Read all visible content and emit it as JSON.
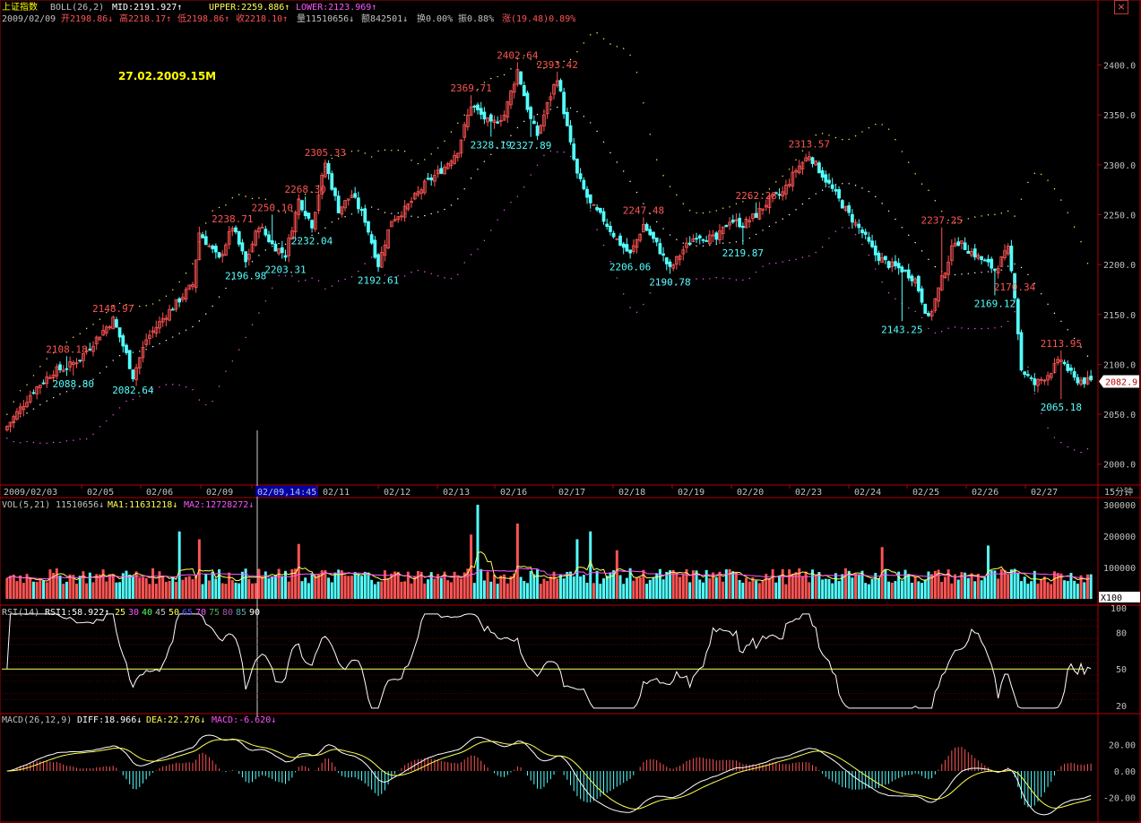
{
  "app": {
    "colors": {
      "background": "#000000",
      "up": "#ff5454",
      "down": "#54ffff",
      "frame": "#b40000",
      "grid": "#4a0000",
      "mid": "#ffffff",
      "upper": "#ffff54",
      "lower": "#ff54ff",
      "axis_text": "#c0c0c0"
    },
    "close_icon_glyph": "×"
  },
  "header": {
    "index_name": "上证指数",
    "boll_label": "BOLL(26,2)",
    "mid_text": "MID:2191.927↑",
    "upper_text": "UPPER:2259.886↑",
    "lower_text": "LOWER:2123.969↑",
    "date_text": "2009/02/09",
    "open_text": "开2198.86↓",
    "high_text": "高2218.17↑",
    "low_text": "低2198.86↑",
    "close_text": "收2218.10↑",
    "vol_text": "量11510656↓",
    "amount_text": "额842501↓",
    "turnover_text": "换0.00%",
    "amplitude_text": "振0.88%",
    "change_text": "涨(19.48)0.89%",
    "watermark": "27.02.2009.15M"
  },
  "xaxis": {
    "labels": [
      "2009/02/03",
      "02/05",
      "02/06",
      "02/09",
      "02/09,14:45",
      "02/11",
      "02/12",
      "02/13",
      "02/16",
      "02/17",
      "02/18",
      "02/19",
      "02/20",
      "02/23",
      "02/24",
      "02/25",
      "02/26",
      "02/27"
    ],
    "cursor_label": "02/09,14:45",
    "period_label": "15分钟"
  },
  "vol_header": {
    "label": "VOL(5,21)",
    "value": "11510656↓",
    "ma1": "MA1:11631218↓",
    "ma2": "MA2:12728272↓"
  },
  "rsi_header": {
    "label": "RSI(14)",
    "value": "RSI1:58.922↑",
    "levels": [
      "25",
      "30",
      "40",
      "45",
      "50",
      "65",
      "70",
      "75",
      "80",
      "85",
      "90"
    ]
  },
  "macd_header": {
    "label": "MACD(26,12,9)",
    "diff": "DIFF:18.966↓",
    "dea": "DEA:22.276↓",
    "macd": "MACD:-6.620↓"
  },
  "chart_data": [
    {
      "type": "candlestick",
      "title": "上证指数 BOLL(26,2)",
      "ylim": [
        1980,
        2440
      ],
      "yticks": [
        2000,
        2050,
        2100,
        2150,
        2200,
        2250,
        2300,
        2350,
        2400
      ],
      "last_price_tag": "2082.9",
      "anchors_close": [
        [
          0,
          2038
        ],
        [
          8,
          2074
        ],
        [
          14,
          2093
        ],
        [
          18,
          2097
        ],
        [
          22,
          2106
        ],
        [
          28,
          2130
        ],
        [
          32,
          2145
        ],
        [
          36,
          2110
        ],
        [
          38,
          2088
        ],
        [
          42,
          2125
        ],
        [
          48,
          2150
        ],
        [
          56,
          2180
        ],
        [
          58,
          2232
        ],
        [
          64,
          2205
        ],
        [
          68,
          2238
        ],
        [
          72,
          2202
        ],
        [
          76,
          2240
        ],
        [
          80,
          2220
        ],
        [
          84,
          2210
        ],
        [
          88,
          2265
        ],
        [
          92,
          2240
        ],
        [
          96,
          2302
        ],
        [
          100,
          2255
        ],
        [
          104,
          2270
        ],
        [
          108,
          2245
        ],
        [
          112,
          2200
        ],
        [
          116,
          2245
        ],
        [
          120,
          2255
        ],
        [
          126,
          2280
        ],
        [
          132,
          2298
        ],
        [
          136,
          2315
        ],
        [
          140,
          2360
        ],
        [
          146,
          2340
        ],
        [
          150,
          2350
        ],
        [
          154,
          2395
        ],
        [
          158,
          2345
        ],
        [
          160,
          2330
        ],
        [
          164,
          2370
        ],
        [
          166,
          2388
        ],
        [
          170,
          2320
        ],
        [
          172,
          2290
        ],
        [
          176,
          2260
        ],
        [
          180,
          2245
        ],
        [
          184,
          2225
        ],
        [
          188,
          2210
        ],
        [
          192,
          2240
        ],
        [
          196,
          2220
        ],
        [
          200,
          2195
        ],
        [
          204,
          2215
        ],
        [
          208,
          2230
        ],
        [
          214,
          2225
        ],
        [
          218,
          2245
        ],
        [
          222,
          2240
        ],
        [
          226,
          2250
        ],
        [
          230,
          2265
        ],
        [
          234,
          2272
        ],
        [
          238,
          2295
        ],
        [
          242,
          2310
        ],
        [
          246,
          2290
        ],
        [
          250,
          2270
        ],
        [
          254,
          2250
        ],
        [
          258,
          2232
        ],
        [
          262,
          2210
        ],
        [
          266,
          2200
        ],
        [
          270,
          2195
        ],
        [
          274,
          2185
        ],
        [
          278,
          2145
        ],
        [
          282,
          2185
        ],
        [
          286,
          2225
        ],
        [
          290,
          2215
        ],
        [
          294,
          2205
        ],
        [
          298,
          2195
        ],
        [
          302,
          2215
        ],
        [
          304,
          2170
        ],
        [
          306,
          2095
        ],
        [
          310,
          2080
        ],
        [
          314,
          2090
        ],
        [
          318,
          2105
        ],
        [
          322,
          2085
        ],
        [
          326,
          2082.9
        ]
      ],
      "high_labels": [
        {
          "bar": 18,
          "value": "2108.18"
        },
        {
          "bar": 32,
          "value": "2148.97"
        },
        {
          "bar": 68,
          "value": "2238.71"
        },
        {
          "bar": 80,
          "value": "2250.10"
        },
        {
          "bar": 90,
          "value": "2268.30"
        },
        {
          "bar": 96,
          "value": "2305.33"
        },
        {
          "bar": 140,
          "value": "2369.71"
        },
        {
          "bar": 154,
          "value": "2402.64"
        },
        {
          "bar": 166,
          "value": "2393.42"
        },
        {
          "bar": 192,
          "value": "2247.48"
        },
        {
          "bar": 226,
          "value": "2262.28"
        },
        {
          "bar": 242,
          "value": "2313.57"
        },
        {
          "bar": 282,
          "value": "2237.25"
        },
        {
          "bar": 304,
          "value": "2170.34"
        },
        {
          "bar": 318,
          "value": "2113.95"
        }
      ],
      "low_labels": [
        {
          "bar": 20,
          "value": "2088.80"
        },
        {
          "bar": 38,
          "value": "2082.64"
        },
        {
          "bar": 72,
          "value": "2196.98"
        },
        {
          "bar": 84,
          "value": "2203.31"
        },
        {
          "bar": 92,
          "value": "2232.04"
        },
        {
          "bar": 112,
          "value": "2192.61"
        },
        {
          "bar": 146,
          "value": "2328.19"
        },
        {
          "bar": 158,
          "value": "2327.89"
        },
        {
          "bar": 188,
          "value": "2206.06"
        },
        {
          "bar": 200,
          "value": "2190.78"
        },
        {
          "bar": 222,
          "value": "2219.87"
        },
        {
          "bar": 270,
          "value": "2143.25"
        },
        {
          "bar": 298,
          "value": "2169.12"
        },
        {
          "bar": 318,
          "value": "2065.18"
        }
      ]
    },
    {
      "type": "bar",
      "title": "VOL(5,21)",
      "ylim": [
        0,
        320000
      ],
      "yticks": [
        100000,
        200000,
        300000
      ],
      "unit_label": "X100",
      "typical_volume": 85000,
      "spikes": [
        [
          52,
          215000
        ],
        [
          58,
          190000
        ],
        [
          88,
          175000
        ],
        [
          140,
          205000
        ],
        [
          142,
          300000
        ],
        [
          154,
          240000
        ],
        [
          172,
          190000
        ],
        [
          176,
          215000
        ],
        [
          184,
          155000
        ],
        [
          264,
          165000
        ],
        [
          296,
          170000
        ]
      ]
    },
    {
      "type": "line",
      "title": "RSI(14)",
      "ylim": [
        15,
        100
      ],
      "yticks": [
        20,
        50,
        80,
        100
      ],
      "reference_line": 50
    },
    {
      "type": "line",
      "title": "MACD(26,12,9)",
      "ylim": [
        -35,
        35
      ],
      "yticks": [
        -20,
        0,
        20
      ]
    }
  ]
}
